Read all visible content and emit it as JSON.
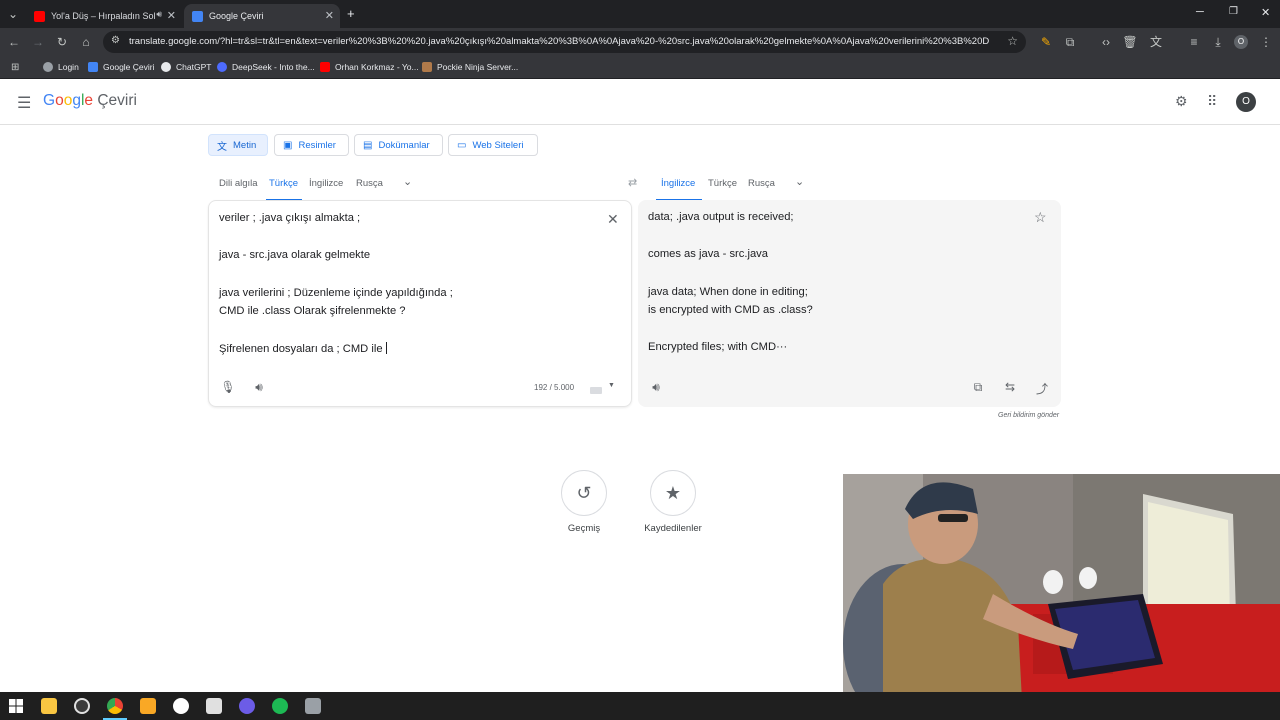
{
  "browser": {
    "tabs": [
      {
        "title": "Yol'a Düş – Hırpaladın Sol Y",
        "active": false
      },
      {
        "title": "Google Çeviri",
        "active": true
      }
    ],
    "new_tab": "+",
    "url": "translate.google.com/?hl=tr&sl=tr&tl=en&text=veriler%20%3B%20%20.java%20çıkışı%20almakta%20%3B%0A%0Ajava%20-%20src.java%20olarak%20gelmekte%0A%0Ajava%20verilerini%20%3B%20Düzenlem...",
    "profile_initial": "O",
    "bookmarks": [
      "Login",
      "Google Çeviri",
      "ChatGPT",
      "DeepSeek - Into the...",
      "Orhan Korkmaz - Yo...",
      "Pockie Ninja Server..."
    ]
  },
  "app": {
    "logo_word": "Google",
    "logo_suffix": "Çeviri",
    "avatar_initial": "O"
  },
  "modes": [
    "Metin",
    "Resimler",
    "Dokümanlar",
    "Web Siteleri"
  ],
  "source_langs": [
    "Dili algıla",
    "Türkçe",
    "İngilizce",
    "Rusça"
  ],
  "target_langs": [
    "İngilizce",
    "Türkçe",
    "Rusça"
  ],
  "source": {
    "lines": [
      "veriler ;  .java çıkışı almakta ;",
      "java - src.java olarak gelmekte",
      "java verilerini ; Düzenleme içinde yapıldığında ;",
      "CMD ile .class Olarak şifrelenmekte ?",
      "Şifrelenen dosyaları da ; CMD ile"
    ],
    "char_count": "192 / 5.000"
  },
  "target": {
    "lines": [
      "data; .java output is received;",
      "comes as java - src.java",
      "java data; When done in editing;",
      "is encrypted with CMD as .class?",
      "Encrypted files; with CMD···"
    ]
  },
  "feedback": "Geri bildirim gönder",
  "history_label": "Geçmiş",
  "saved_label": "Kaydedilenler",
  "colors": {
    "accent": "#1a73e8",
    "chrome_dark": "#202124",
    "chrome_mid": "#35363a"
  }
}
